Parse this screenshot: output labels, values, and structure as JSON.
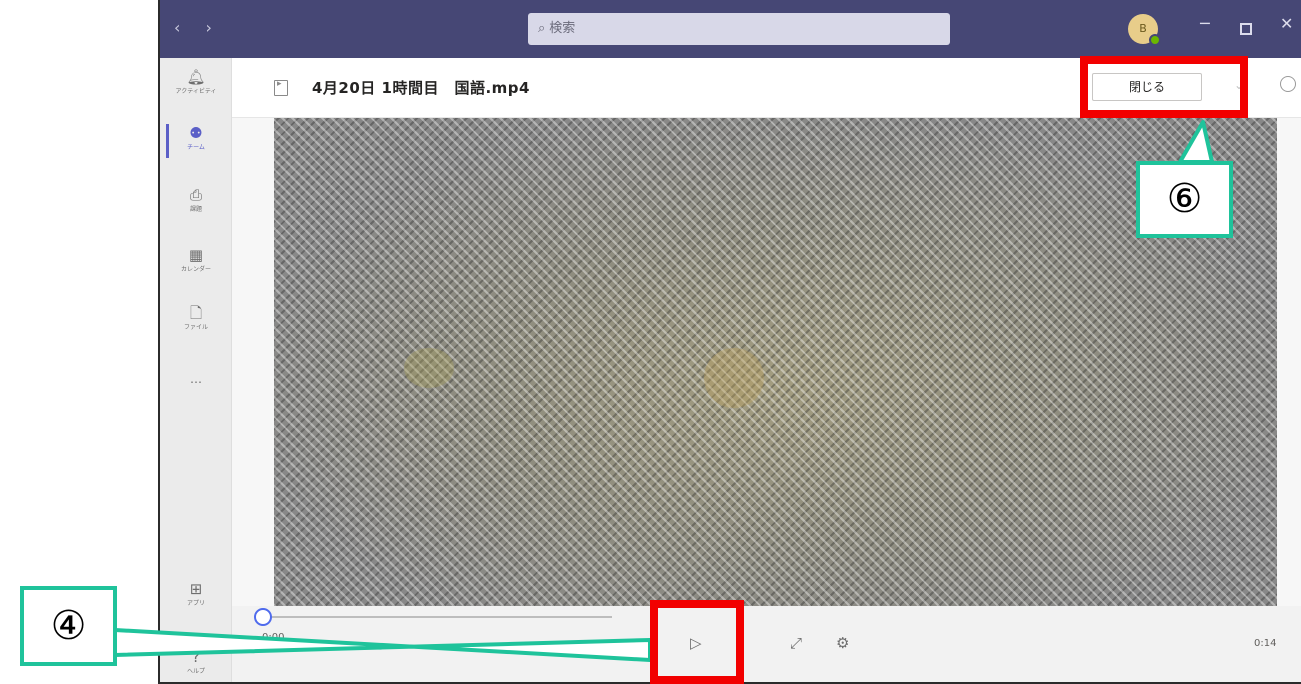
{
  "titlebar": {
    "nav_arrows": "‹  ›",
    "search_placeholder": "検索",
    "avatar_initial": "B"
  },
  "rail": {
    "items": [
      {
        "label": "アクティビティ",
        "icon": "bell-icon"
      },
      {
        "label": "チーム",
        "icon": "teams-icon"
      },
      {
        "label": "課題",
        "icon": "assignments-icon"
      },
      {
        "label": "カレンダー",
        "icon": "calendar-icon"
      },
      {
        "label": "ファイル",
        "icon": "file-icon"
      },
      {
        "label": "…",
        "icon": "more-icon"
      },
      {
        "label": "アプリ",
        "icon": "apps-icon"
      },
      {
        "label": "ヘルプ",
        "icon": "help-icon"
      }
    ]
  },
  "file": {
    "title": "4月20日 1時間目　国語.mp4",
    "close_label": "閉じる"
  },
  "player": {
    "current_time": "0:00",
    "total_time": "0:14",
    "progress": 0
  },
  "annotations": {
    "callout_close": "⑥",
    "callout_play": "④",
    "highlight_color": "#f20000",
    "callout_color": "#1fc39b"
  },
  "colors": {
    "titlebar": "#464775",
    "accent": "#5b5fc7"
  }
}
